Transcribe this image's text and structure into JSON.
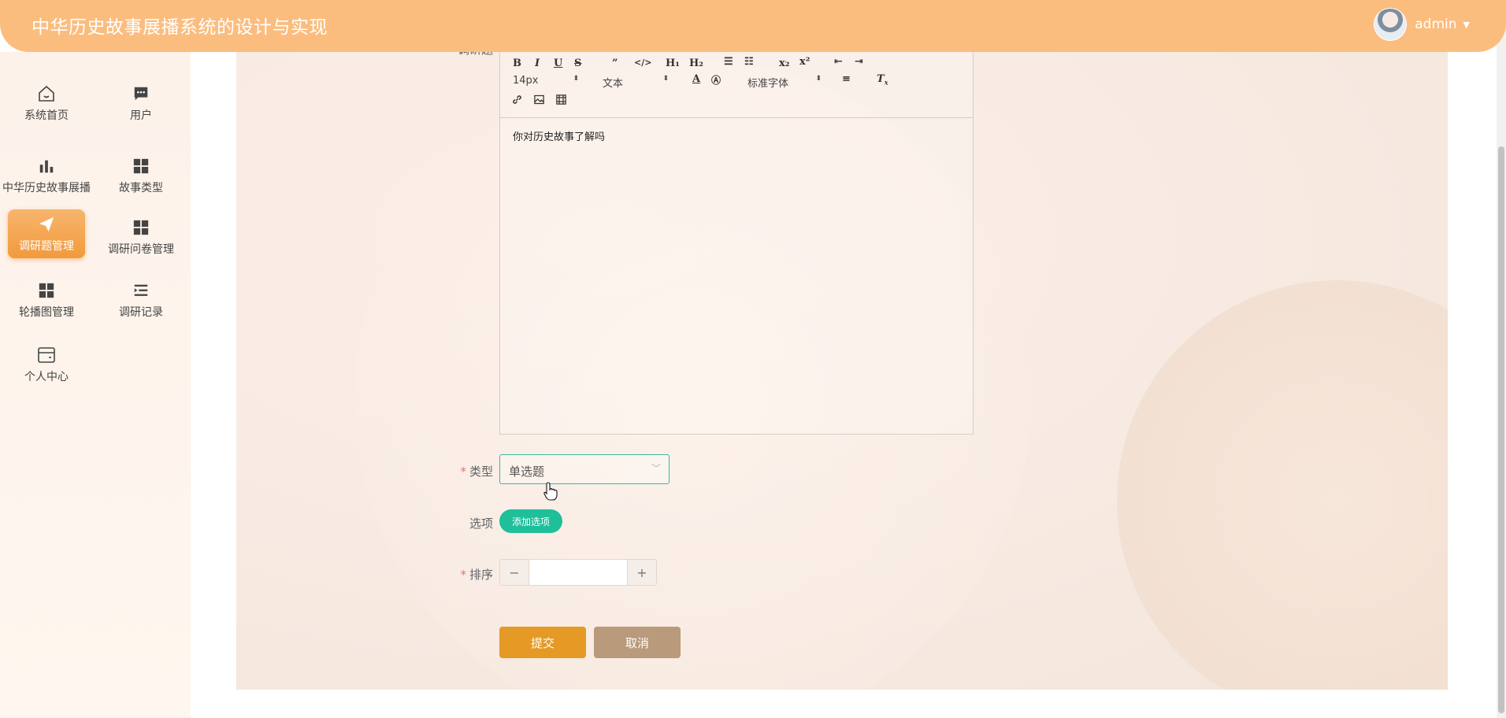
{
  "header": {
    "title": "中华历史故事展播系统的设计与实现",
    "username": "admin"
  },
  "sidebar": {
    "items": [
      {
        "label": "系统首页",
        "icon": "home-icon"
      },
      {
        "label": "用户",
        "icon": "chat-icon"
      },
      {
        "label": "中华历史故事展播",
        "icon": "bar-chart-icon"
      },
      {
        "label": "故事类型",
        "icon": "grid-icon"
      },
      {
        "label": "调研题管理",
        "icon": "paper-plane-icon",
        "active": true
      },
      {
        "label": "调研问卷管理",
        "icon": "grid-icon"
      },
      {
        "label": "轮播图管理",
        "icon": "grid-icon"
      },
      {
        "label": "调研记录",
        "icon": "list-indent-icon"
      },
      {
        "label": "个人中心",
        "icon": "wallet-icon"
      }
    ]
  },
  "form": {
    "question_label_partial": "调研题",
    "editor": {
      "font_size": "14px",
      "block_type": "文本",
      "font_family": "标准字体",
      "content": "你对历史故事了解吗"
    },
    "type_label": "类型",
    "type_value": "单选题",
    "options_label": "选项",
    "add_option_label": "添加选项",
    "order_label": "排序",
    "order_value": "",
    "submit_label": "提交",
    "cancel_label": "取消"
  },
  "colors": {
    "header_bg": "#fbbd7e",
    "active_nav": "#f29a3b",
    "add_option_bg": "#1fbf9a",
    "submit_bg": "#e49a24",
    "cancel_bg": "#b99a7b",
    "required_mark": "#f56c6c"
  }
}
